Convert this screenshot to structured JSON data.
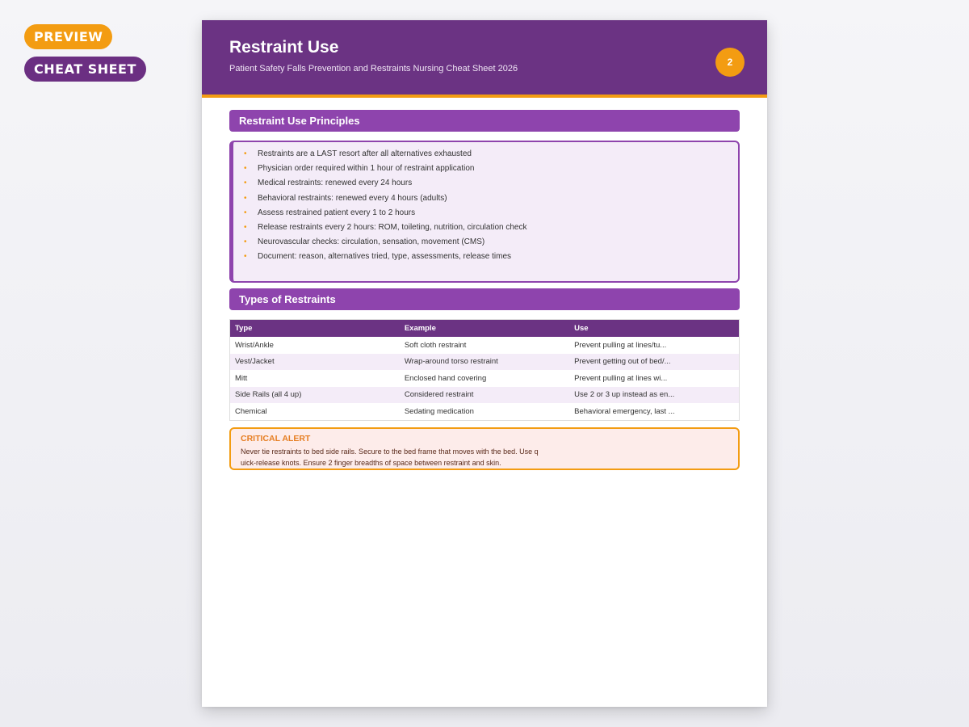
{
  "badges": {
    "preview": "PREVIEW",
    "cheat_sheet": "CHEAT SHEET"
  },
  "header": {
    "title": "Restraint Use",
    "subtitle": "Patient Safety Falls Prevention and Restraints Nursing Cheat Sheet 2026",
    "page_number": "2"
  },
  "principles": {
    "heading": "Restraint Use Principles",
    "items": [
      "Restraints are a LAST resort after all alternatives exhausted",
      "Physician order required within 1 hour of restraint application",
      "Medical restraints: renewed every 24 hours",
      "Behavioral restraints: renewed every 4 hours (adults)",
      "Assess restrained patient every 1 to 2 hours",
      "Release restraints every 2 hours: ROM, toileting, nutrition, circulation check",
      "Neurovascular checks: circulation, sensation, movement (CMS)",
      "Document: reason, alternatives tried, type, assessments, release times"
    ]
  },
  "types": {
    "heading": "Types of Restraints",
    "columns": [
      "Type",
      "Example",
      "Use"
    ],
    "rows": [
      [
        "Wrist/Ankle",
        "Soft cloth restraint",
        "Prevent pulling at lines/tu..."
      ],
      [
        "Vest/Jacket",
        "Wrap-around torso restraint",
        "Prevent getting out of bed/..."
      ],
      [
        "Mitt",
        "Enclosed hand covering",
        "Prevent pulling at lines wi..."
      ],
      [
        "Side Rails (all 4 up)",
        "Considered restraint",
        "Use 2 or 3 up instead as en..."
      ],
      [
        "Chemical",
        "Sedating medication",
        "Behavioral emergency, last ..."
      ]
    ]
  },
  "alert": {
    "title": "CRITICAL ALERT",
    "text": "Never tie restraints to bed side rails. Secure to the bed frame that moves with the bed. Use quick-release knots. Ensure 2 finger breadths of space between restraint and skin."
  },
  "colors": {
    "header_purple": "#6b3383",
    "section_purple": "#8e44ad",
    "accent_orange": "#f39c12"
  }
}
